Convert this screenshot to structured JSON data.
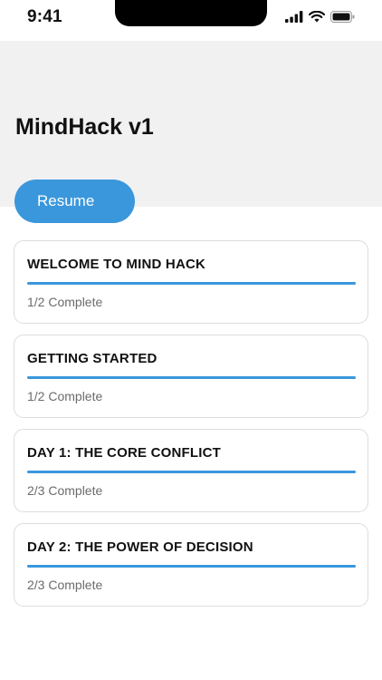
{
  "status_bar": {
    "time": "9:41",
    "icons": [
      "signal-icon",
      "wifi-icon",
      "battery-icon"
    ]
  },
  "header": {
    "title": "MindHack v1",
    "resume_label": "Resume"
  },
  "colors": {
    "accent": "#3a97dc",
    "header_background": "#f1f1f1",
    "card_border": "#dcdcdc",
    "muted_text": "#6b6b6b"
  },
  "modules": [
    {
      "title": "WELCOME TO MIND HACK",
      "status": "1/2 Complete",
      "progress": 1.0
    },
    {
      "title": "GETTING STARTED",
      "status": "1/2 Complete",
      "progress": 1.0
    },
    {
      "title": "DAY 1: THE CORE CONFLICT",
      "status": "2/3 Complete",
      "progress": 1.0
    },
    {
      "title": "DAY 2: THE POWER OF DECISION",
      "status": "2/3 Complete",
      "progress": 1.0
    }
  ]
}
